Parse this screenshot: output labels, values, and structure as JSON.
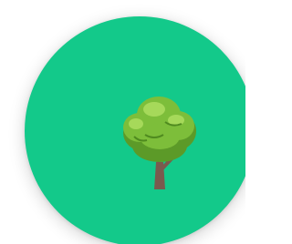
{
  "app_button": {
    "icon": "deciduous-tree-icon",
    "accent_color": "#13c98a"
  }
}
